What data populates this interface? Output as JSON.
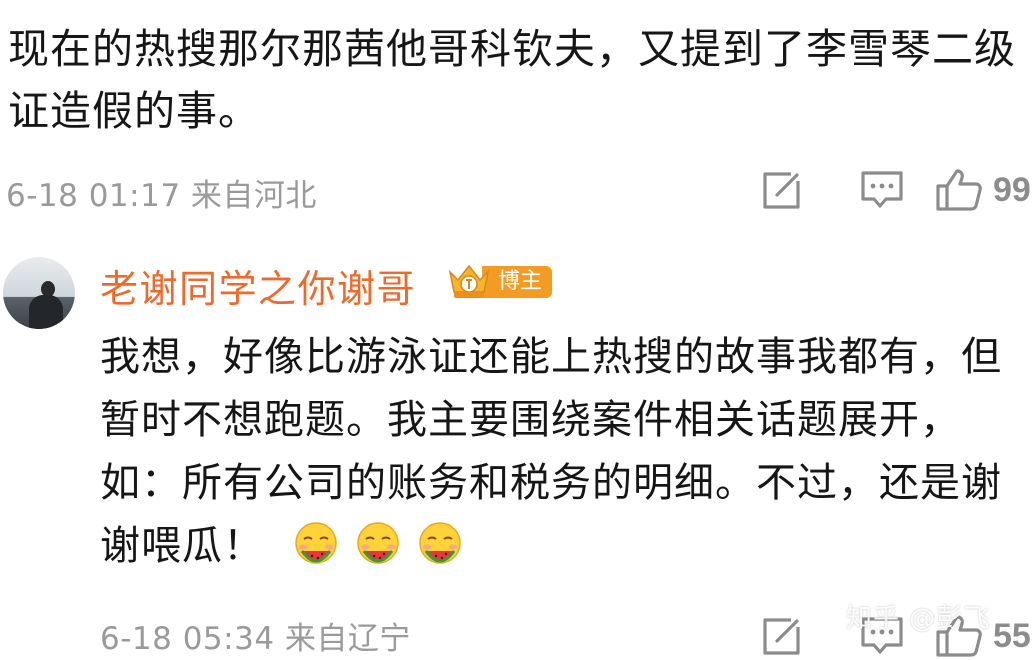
{
  "comment_1": {
    "text": "现在的热搜那尔那茜他哥科钦夫，又提到了李雪琴二级证造假的事。",
    "meta": "6-18 01:17  来自河北",
    "like_count": "99"
  },
  "comment_2": {
    "username": "老谢同学之你谢哥",
    "badge_label": "博主",
    "text": "我想，好像比游泳证还能上热搜的故事我都有，但暂时不想跑题。我主要围绕案件相关话题展开，如：所有公司的账务和税务的明细。不过，还是谢谢喂瓜！",
    "emojis": [
      "eating-watermelon-emoji",
      "eating-watermelon-emoji",
      "eating-watermelon-emoji"
    ],
    "meta": "6-18 05:34  来自辽宁",
    "like_count": "55"
  },
  "watermark": "知乎 @彭飞",
  "icons": {
    "edit": "edit-icon",
    "comment": "comment-icon",
    "like": "thumbs-up-icon"
  },
  "colors": {
    "username": "#ef6a2a",
    "badge": "#f39b23",
    "meta_text": "#9a9a9a",
    "icon_gray": "#8c8c8c"
  }
}
